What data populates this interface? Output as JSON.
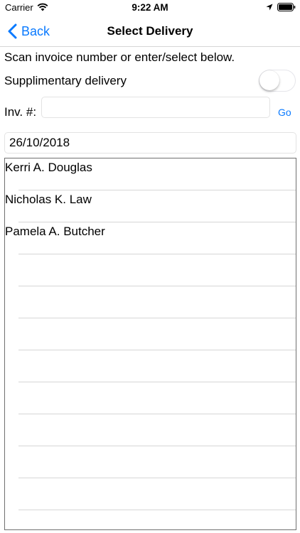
{
  "status_bar": {
    "carrier": "Carrier",
    "time": "9:22 AM"
  },
  "nav": {
    "back_label": "Back",
    "title": "Select Delivery"
  },
  "form": {
    "instruction": "Scan invoice number or enter/select below.",
    "supplementary_label": "Supplimentary delivery",
    "supplementary_on": false,
    "invoice_label": "Inv. #:",
    "invoice_value": "",
    "go_label": "Go",
    "date_value": "26/10/2018"
  },
  "list": {
    "items": [
      {
        "label": "Kerri A. Douglas"
      },
      {
        "label": "Nicholas K. Law"
      },
      {
        "label": "Pamela A. Butcher"
      },
      {
        "label": ""
      },
      {
        "label": ""
      },
      {
        "label": ""
      },
      {
        "label": ""
      },
      {
        "label": ""
      },
      {
        "label": ""
      },
      {
        "label": ""
      },
      {
        "label": ""
      },
      {
        "label": ""
      }
    ]
  },
  "colors": {
    "accent": "#0a7aff",
    "separator": "#d6d6d6"
  }
}
